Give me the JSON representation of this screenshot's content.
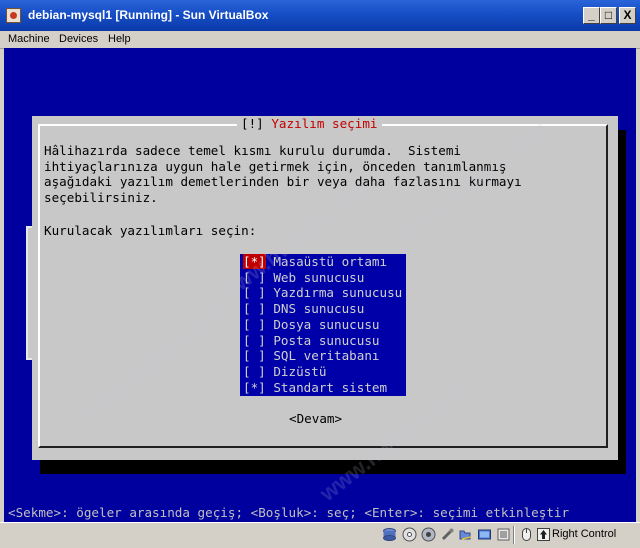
{
  "window": {
    "title": "debian-mysql1 [Running] - Sun VirtualBox",
    "minimize": "_",
    "maximize": "□",
    "close": "X"
  },
  "menu": [
    "Machine",
    "Devices",
    "Help"
  ],
  "dialog": {
    "title": "[!] Yazılım seçimi",
    "title_bracket": "[!]",
    "title_text": "Yazılım seçimi",
    "description": "Hâlihazırda sadece temel kısmı kurulu durumda.  Sistemi\nihtiyaçlarınıza uygun hale getirmek için, önceden tanımlanmış\naşağıdaki yazılım demetlerinden bir veya daha fazlasını kurmayı\nseçebilirsiniz.",
    "prompt": "Kurulacak yazılımları seçin:",
    "options": [
      {
        "check": "[*]",
        "label": "Masaüstü ortamı",
        "selected": true,
        "focused": true
      },
      {
        "check": "[ ]",
        "label": "Web sunucusu",
        "selected": false
      },
      {
        "check": "[ ]",
        "label": "Yazdırma sunucusu",
        "selected": false
      },
      {
        "check": "[ ]",
        "label": "DNS sunucusu",
        "selected": false
      },
      {
        "check": "[ ]",
        "label": "Dosya sunucusu",
        "selected": false
      },
      {
        "check": "[ ]",
        "label": "Posta sunucusu",
        "selected": false
      },
      {
        "check": "[ ]",
        "label": "SQL veritabanı",
        "selected": false
      },
      {
        "check": "[ ]",
        "label": "Dizüstü",
        "selected": false
      },
      {
        "check": "[*]",
        "label": "Standart sistem",
        "selected": true
      }
    ],
    "continue_button": "<Devam>"
  },
  "help_line": "<Sekme>: ögeler arasında geçiş; <Boşluk>: seç; <Enter>: seçimi etkinleştir",
  "statusbar": {
    "host_key": "Right Control",
    "icons": [
      "hard-disk-icon",
      "cd-icon",
      "floppy-icon",
      "usb-icon",
      "shared-folder-icon",
      "network-icon",
      "virtualization-icon",
      "mouse-integration-icon"
    ]
  },
  "colors": {
    "titlebar": "#1850c8",
    "screen_bg": "#00009f",
    "dialog_bg": "#c8c8c8",
    "dialog_title": "#c00000",
    "list_bg": "#0000a8",
    "focus": "#c00000"
  }
}
